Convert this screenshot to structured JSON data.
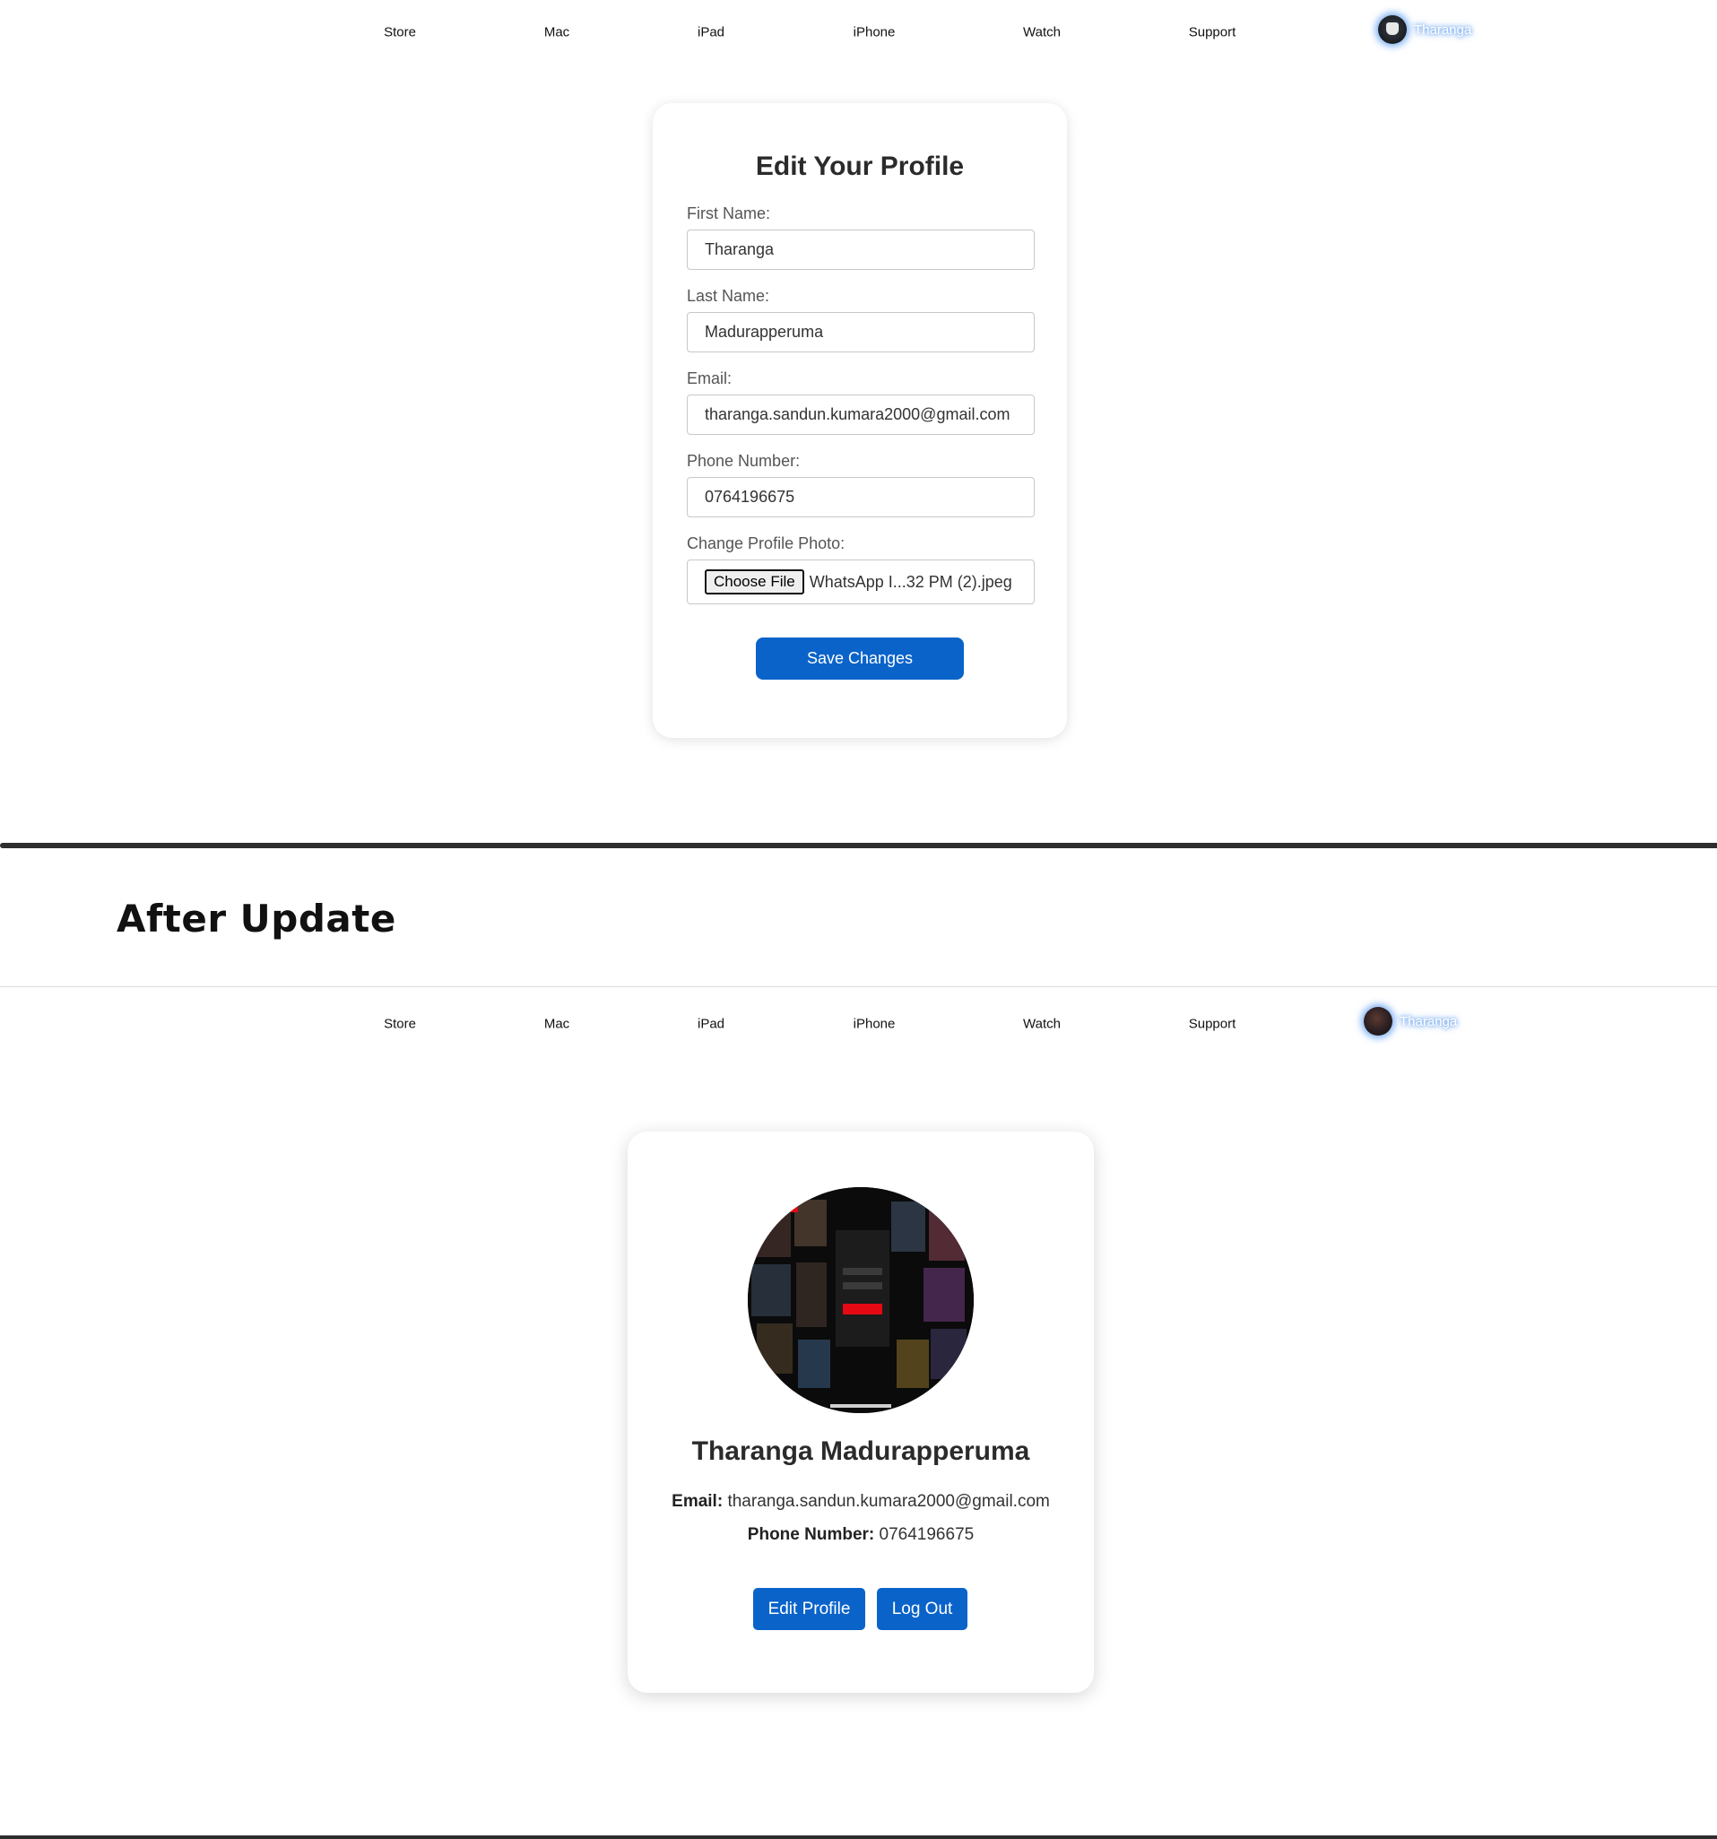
{
  "nav": {
    "items": [
      "Store",
      "Mac",
      "iPad",
      "iPhone",
      "Watch",
      "Support"
    ],
    "username": "Tharanga"
  },
  "edit_profile": {
    "title": "Edit Your Profile",
    "fields": {
      "first_name": {
        "label": "First Name:",
        "value": "Tharanga"
      },
      "last_name": {
        "label": "Last Name:",
        "value": "Madurapperuma"
      },
      "email": {
        "label": "Email:",
        "value": "tharanga.sandun.kumara2000@gmail.com"
      },
      "phone": {
        "label": "Phone Number:",
        "value": "0764196675"
      },
      "photo": {
        "label": "Change Profile Photo:",
        "button": "Choose File",
        "file_name": "WhatsApp I...32 PM (2).jpeg"
      }
    },
    "save_label": "Save Changes"
  },
  "section_title": "After Update",
  "profile": {
    "name": "Tharanga Madurapperuma",
    "email_label": "Email:",
    "email": "tharanga.sandun.kumara2000@gmail.com",
    "phone_label": "Phone Number:",
    "phone": "0764196675",
    "edit_label": "Edit Profile",
    "logout_label": "Log Out"
  },
  "colors": {
    "primary_button": "#0a63c9",
    "user_glow": "#468ceb"
  }
}
